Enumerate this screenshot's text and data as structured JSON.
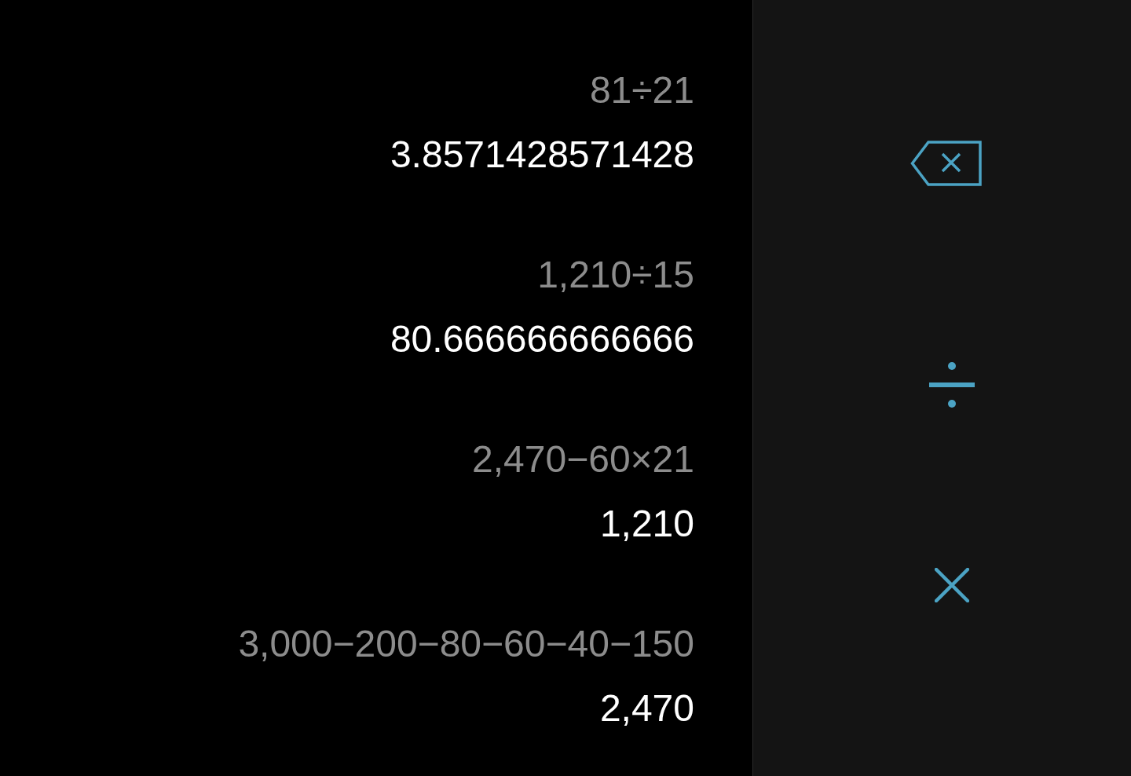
{
  "history": [
    {
      "expression": "81÷21",
      "result": "3.8571428571428"
    },
    {
      "expression": "1,210÷15",
      "result": "80.666666666666"
    },
    {
      "expression": "2,470−60×21",
      "result": "1,210"
    },
    {
      "expression": "3,000−200−80−60−40−150",
      "result": "2,470"
    }
  ],
  "keys": [
    {
      "kind": "backspace"
    },
    {
      "kind": "divide"
    },
    {
      "kind": "multiply"
    }
  ]
}
